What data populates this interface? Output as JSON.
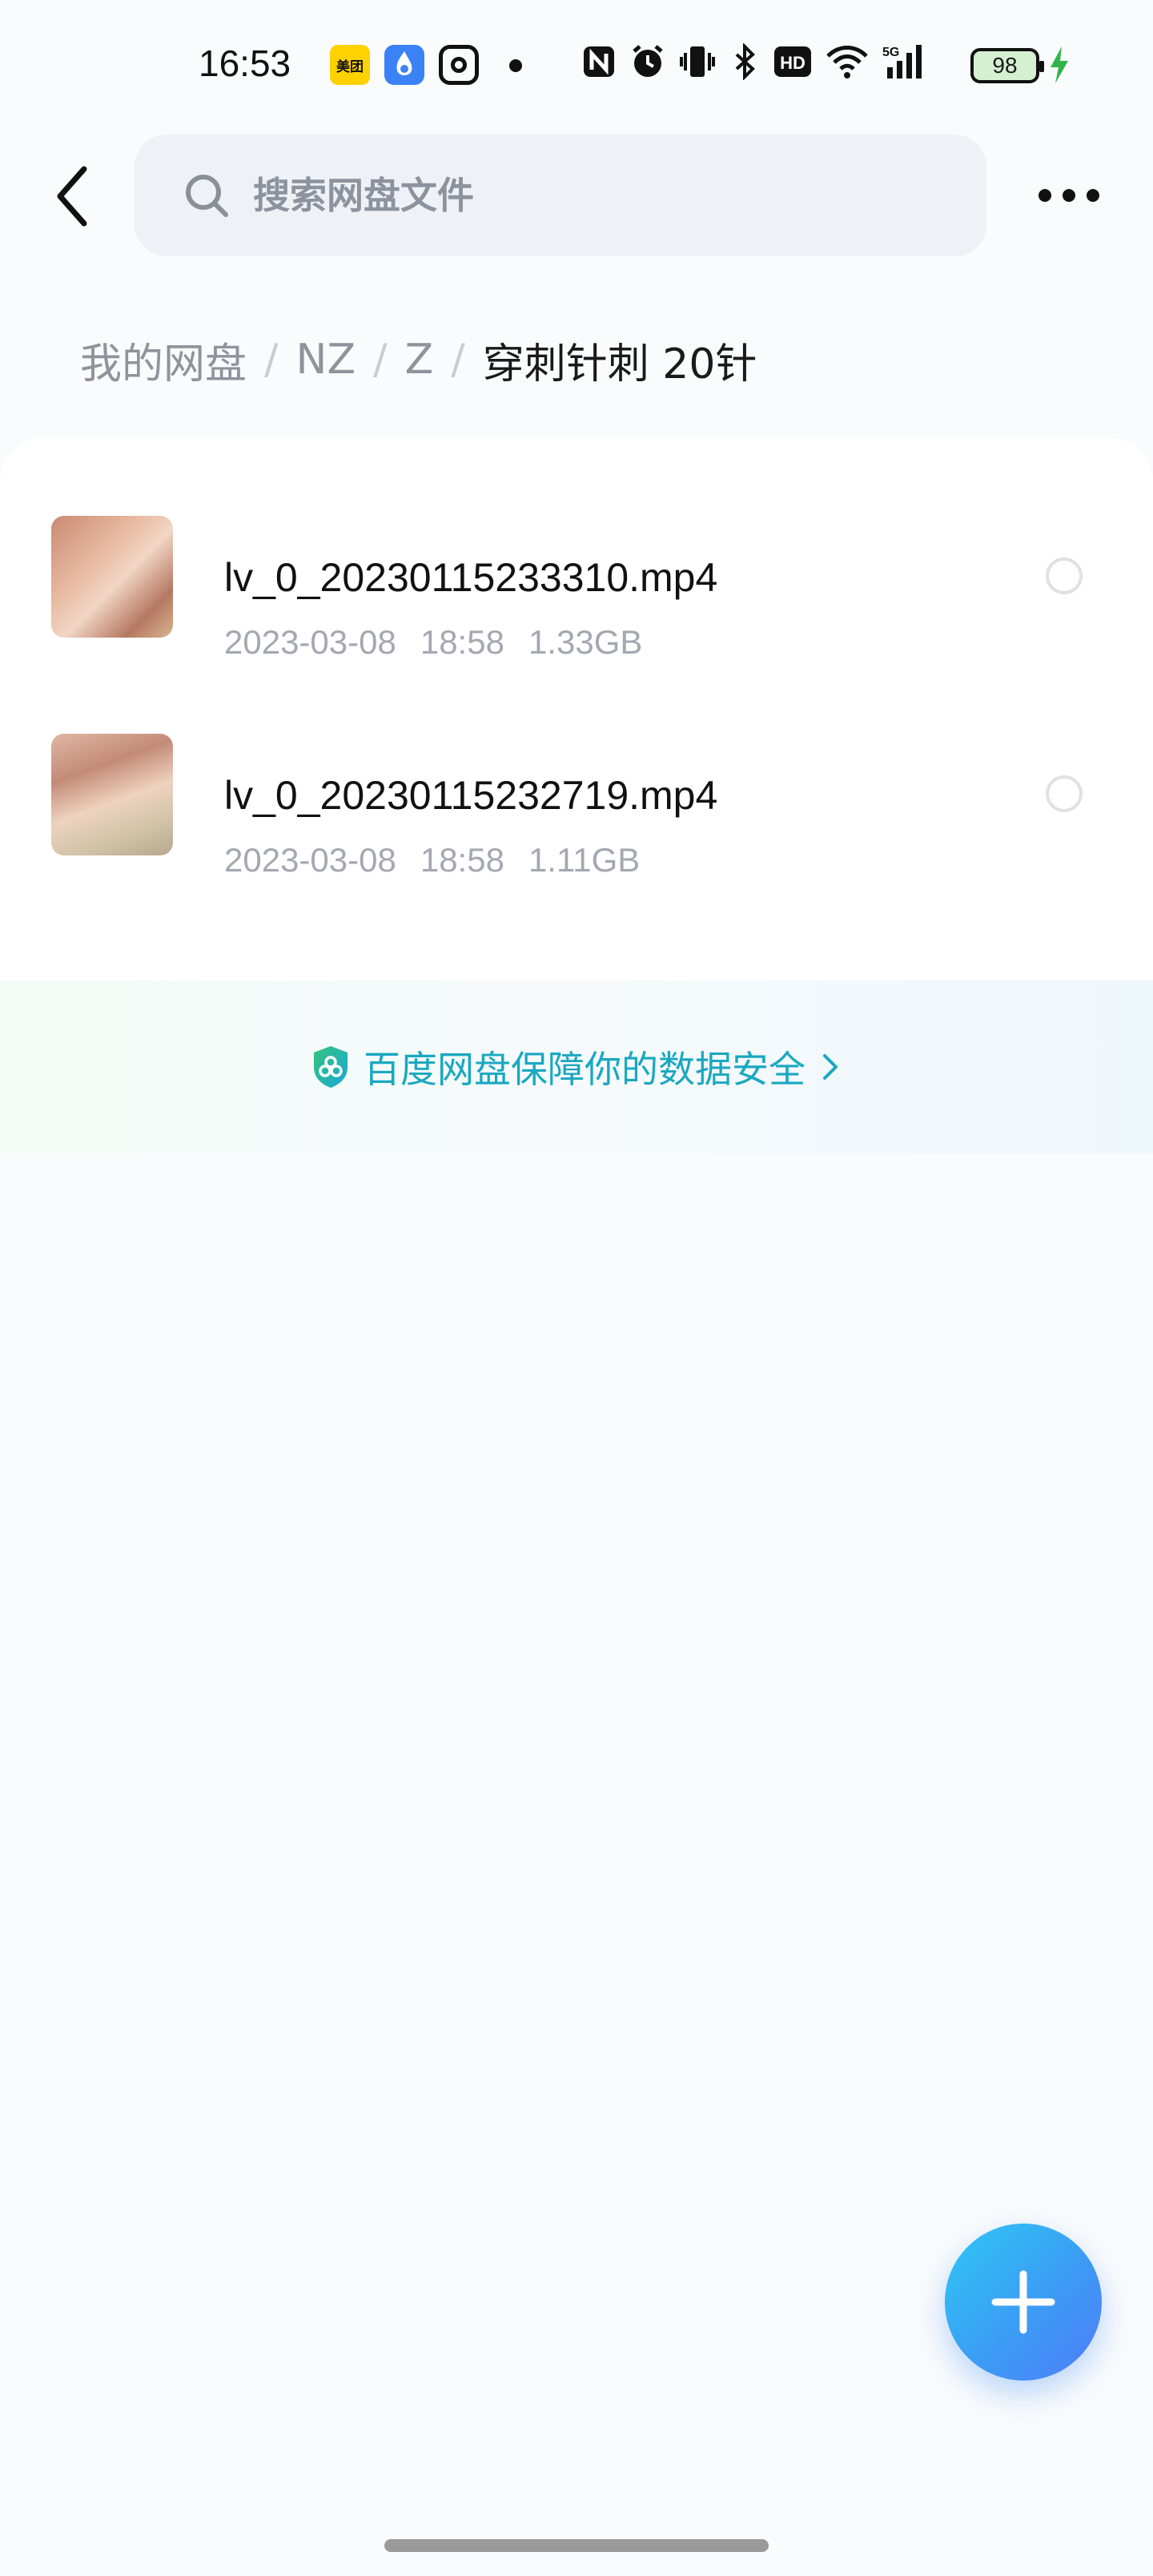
{
  "status_bar": {
    "time": "16:53",
    "app_icons": [
      "meituan-icon",
      "blue-app-icon",
      "instagram-icon"
    ],
    "meituan_text": "美团",
    "system_icons": [
      "nfc-icon",
      "alarm-icon",
      "vibrate-icon",
      "bluetooth-icon",
      "hd-icon",
      "wifi-icon",
      "signal-5g-icon"
    ],
    "battery_level": "98",
    "charging": true
  },
  "header": {
    "search_placeholder": "搜索网盘文件"
  },
  "breadcrumb": {
    "items": [
      "我的网盘",
      "NZ",
      "Z"
    ],
    "separator": "/",
    "current": "穿刺针刺 20针"
  },
  "files": [
    {
      "name": "lv_0_20230115233310.mp4",
      "date": "2023-03-08",
      "time": "18:58",
      "size": "1.33GB"
    },
    {
      "name": "lv_0_20230115232719.mp4",
      "date": "2023-03-08",
      "time": "18:58",
      "size": "1.11GB"
    }
  ],
  "security_banner": {
    "text": "百度网盘保障你的数据安全"
  },
  "colors": {
    "accent": "#1aa8c0",
    "fab_start": "#2fc8f4",
    "fab_end": "#4f7cf6",
    "battery_fill": "#d5efd1",
    "charging": "#34b34a"
  }
}
